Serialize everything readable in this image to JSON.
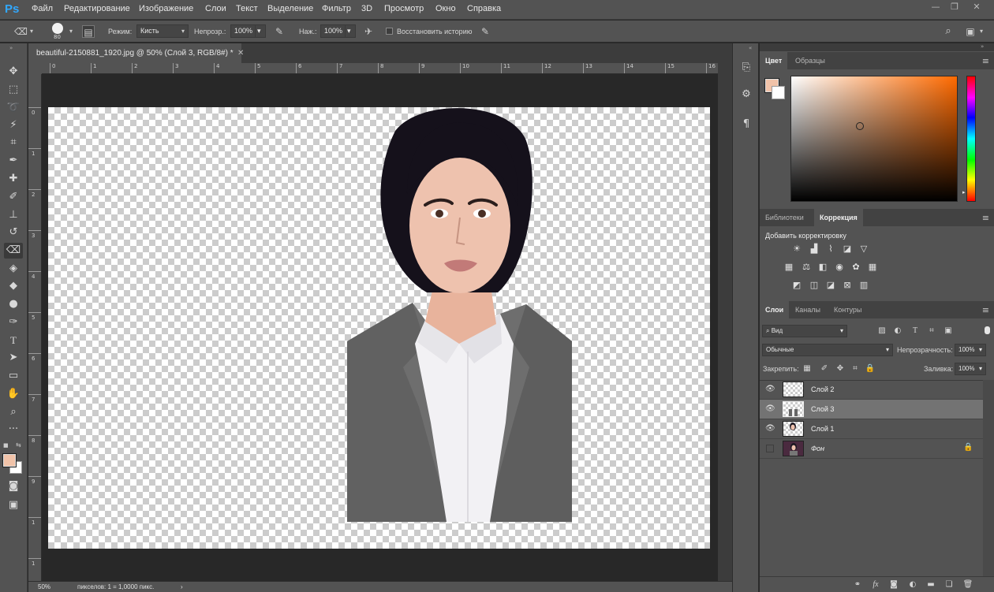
{
  "app": {
    "logo": "Ps"
  },
  "menu": [
    "Файл",
    "Редактирование",
    "Изображение",
    "Слои",
    "Текст",
    "Выделение",
    "Фильтр",
    "3D",
    "Просмотр",
    "Окно",
    "Справка"
  ],
  "options": {
    "brush_size": "80",
    "mode_label": "Режим:",
    "mode_value": "Кисть",
    "opacity_label": "Непрозр.:",
    "opacity_value": "100%",
    "flow_label": "Наж.:",
    "flow_value": "100%",
    "restore_history_label": "Восстановить историю",
    "restore_history_checked": false
  },
  "document": {
    "tab_title": "beautiful-2150881_1920.jpg @ 50% (Слой 3, RGB/8#) *",
    "ruler_h": [
      "0",
      "1",
      "2",
      "3",
      "4",
      "5",
      "6",
      "7",
      "8",
      "9",
      "10",
      "11",
      "12",
      "13",
      "14",
      "15",
      "16"
    ],
    "ruler_v": [
      "0",
      "1",
      "2",
      "3",
      "4",
      "5",
      "6",
      "7",
      "8",
      "9",
      "1",
      "1"
    ]
  },
  "status": {
    "zoom": "50%",
    "info": "пикселов: 1 = 1,0000 пикс."
  },
  "colors": {
    "foreground": "#f1c3a9",
    "background": "#ffffff",
    "accent": "#31a8ff"
  },
  "panels": {
    "color_tabs": [
      "Цвет",
      "Образцы"
    ],
    "adjust_tabs": [
      "Библиотеки",
      "Коррекция"
    ],
    "adjust_title": "Добавить корректировку",
    "layers_tabs": [
      "Слои",
      "Каналы",
      "Контуры"
    ],
    "filter_kind": "Вид",
    "blend_mode": "Обычные",
    "opacity_label": "Непрозрачность:",
    "opacity_value": "100%",
    "lock_label": "Закрепить:",
    "fill_label": "Заливка:",
    "fill_value": "100%"
  },
  "layers": [
    {
      "name": "Слой 2",
      "visible": true,
      "selected": false,
      "locked": false,
      "thumb": "transparent"
    },
    {
      "name": "Слой 3",
      "visible": true,
      "selected": true,
      "locked": false,
      "thumb": "portrait-body"
    },
    {
      "name": "Слой 1",
      "visible": true,
      "selected": false,
      "locked": false,
      "thumb": "portrait-head"
    },
    {
      "name": "Фон",
      "visible": false,
      "selected": false,
      "locked": true,
      "thumb": "photo"
    }
  ]
}
